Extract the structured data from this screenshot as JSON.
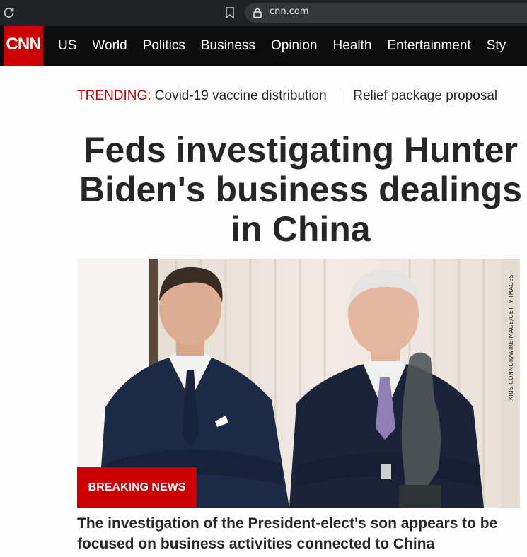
{
  "browser": {
    "url": "cnn.com"
  },
  "nav": {
    "logo": "CNN",
    "items": [
      "US",
      "World",
      "Politics",
      "Business",
      "Opinion",
      "Health",
      "Entertainment",
      "Sty"
    ]
  },
  "trending": {
    "label": "TRENDING:",
    "items": [
      "Covid-19 vaccine distribution",
      "Relief package proposal"
    ]
  },
  "article": {
    "headline": "Feds investigating Hunter Biden's business dealings in China",
    "photo_credit": "KRIS CONNOR/WIREIMAGE/GETTY IMAGES",
    "badge": "BREAKING NEWS",
    "summary": "The investigation of the President-elect's son appears to be focused on business activities connected to China"
  },
  "colors": {
    "brand_red": "#cc0000",
    "nav_bg": "#0c0c0c",
    "browser_bg": "#202124"
  }
}
